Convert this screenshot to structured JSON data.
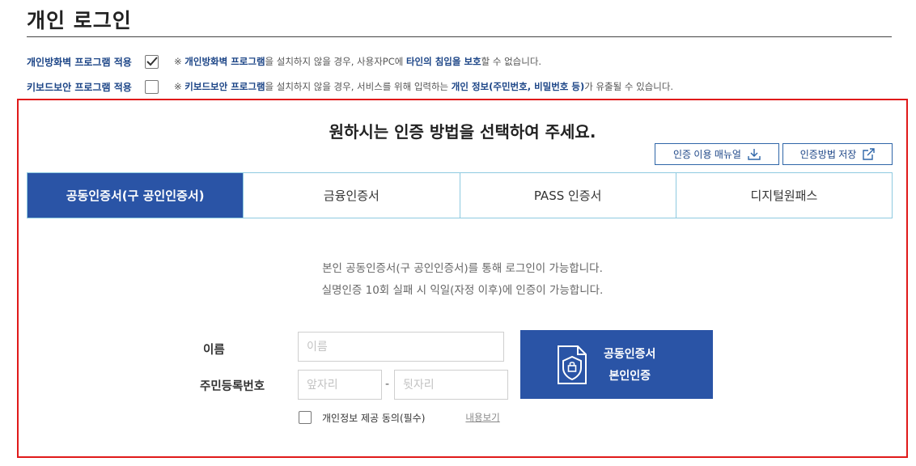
{
  "page": {
    "title": "개인 로그인"
  },
  "options": [
    {
      "label": "개인방화벽 프로그램 적용",
      "checked": true,
      "note_prefix": "※ ",
      "note_hl1": "개인방화벽 프로그램",
      "note_mid": "을 설치하지 않을 경우, 사용자PC에 ",
      "note_hl2": "타인의 침입을 보호",
      "note_suffix": "할 수 없습니다."
    },
    {
      "label": "키보드보안 프로그램 적용",
      "checked": false,
      "note_prefix": "※ ",
      "note_hl1": "키보드보안 프로그램",
      "note_mid": "을 설치하지 않을 경우, 서비스를 위해 입력하는 ",
      "note_hl2": "개인 정보(주민번호, 비밀번호 등)",
      "note_suffix": "가 유출될 수 있습니다."
    }
  ],
  "auth": {
    "heading": "원하시는 인증 방법을 선택하여 주세요.",
    "manual_button": {
      "label": "인증 이용 매뉴얼",
      "icon": "download-icon"
    },
    "save_button": {
      "label": "인증방법 저장",
      "icon": "external-link-icon"
    },
    "tabs": [
      {
        "label": "공동인증서(구 공인인증서)",
        "active": true
      },
      {
        "label": "금융인증서",
        "active": false
      },
      {
        "label": "PASS 인증서",
        "active": false
      },
      {
        "label": "디지털원패스",
        "active": false
      }
    ],
    "desc_line1": "본인 공동인증서(구 공인인증서)를 통해 로그인이 가능합니다.",
    "desc_line2": "실명인증 10회 실패 시 익일(자정 이후)에 인증이 가능합니다.",
    "name_label": "이름",
    "name_placeholder": "이름",
    "name_value": "",
    "rrn_label": "주민등록번호",
    "rrn_front_placeholder": "앞자리",
    "rrn_front_value": "",
    "rrn_separator": "-",
    "rrn_back_placeholder": "뒷자리",
    "rrn_back_value": "",
    "cert_button": {
      "line1": "공동인증서",
      "line2": "본인인증",
      "icon": "certificate-shield-icon"
    },
    "agree": {
      "label": "개인정보 제공 동의(필수)",
      "checked": false,
      "link": "내용보기"
    }
  },
  "colors": {
    "accent_blue": "#2a54a6",
    "label_blue": "#1c4587",
    "highlight_border": "#e01a1a",
    "tab_border": "#8ecae0"
  }
}
